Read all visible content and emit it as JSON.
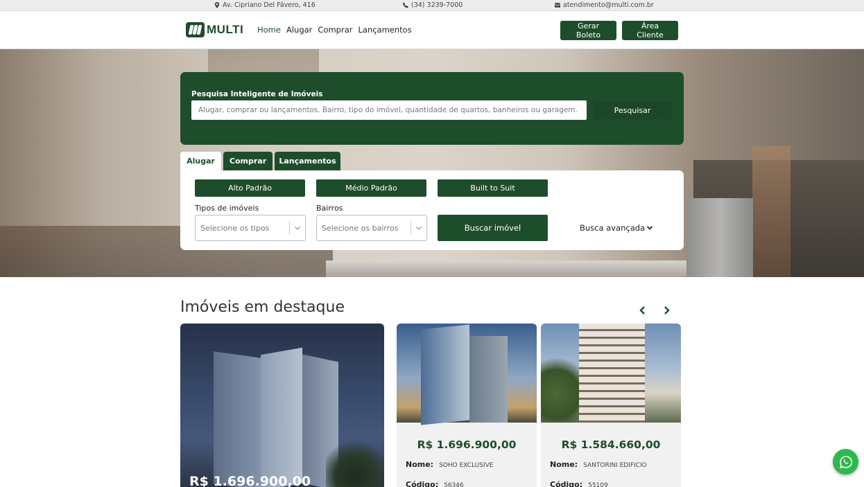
{
  "topbar": {
    "address": "Av. Cipriano Del Fávero, 416",
    "phone": "(34) 3239-7000",
    "email": "atendimento@multi.com.br"
  },
  "header": {
    "logo_text": "MULTI",
    "nav": [
      "Home",
      "Alugar",
      "Comprar",
      "Lançamentos"
    ],
    "active_nav": "Home",
    "boleto_label": "Gerar Boleto",
    "client_label": "Área Cliente"
  },
  "search": {
    "title": "Pesquisa Inteligente de Imóveis",
    "placeholder": "Alugar, comprar ou lançamentos. Bairro, tipo do imóvel, quantidade de quartos, banheiros ou garagem.",
    "button": "Pesquisar"
  },
  "tabs": [
    "Alugar",
    "Comprar",
    "Lançamentos"
  ],
  "active_tab": "Alugar",
  "filters": {
    "categories": [
      "Alto Padrão",
      "Médio Padrão",
      "Built to Suit"
    ],
    "types_label": "Tipos de imóveis",
    "types_placeholder": "Selecione os tipos",
    "neighborhoods_label": "Bairros",
    "neighborhoods_placeholder": "Selecione os bairros",
    "search_button": "Buscar imóvel",
    "advanced": "Busca avançada"
  },
  "featured": {
    "title": "Imóveis em destaque",
    "main_price": "R$ 1.696.900,00",
    "cards": [
      {
        "price": "R$ 1.696.900,00",
        "name_label": "Nome:",
        "name": "SOHO EXCLUSIVE",
        "code_label": "Código:",
        "code": "56346"
      },
      {
        "price": "R$ 1.584.660,00",
        "name_label": "Nome:",
        "name": "SANTORINI EDIFICIO",
        "code_label": "Código:",
        "code": "55109"
      }
    ]
  },
  "colors": {
    "brand": "#1e4d2b",
    "whatsapp": "#2fb84c"
  }
}
